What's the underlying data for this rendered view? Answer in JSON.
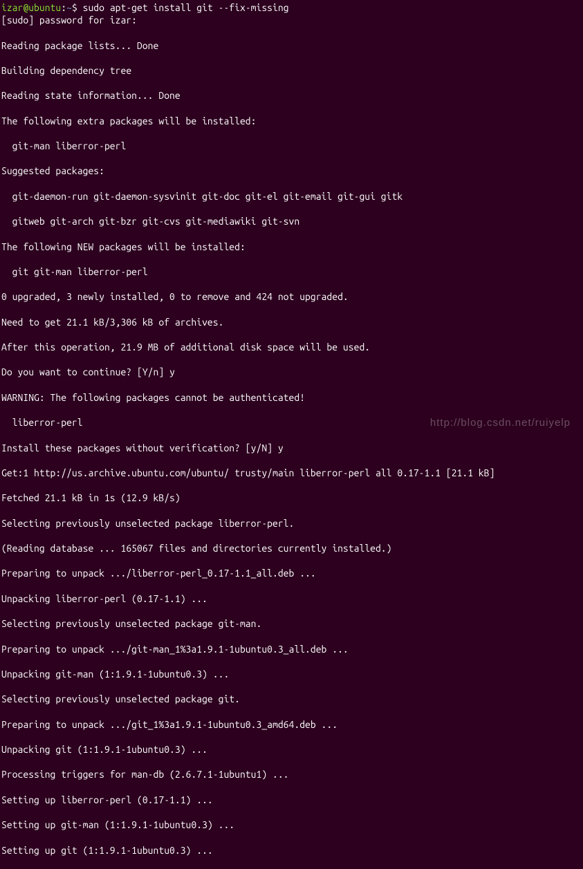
{
  "prompt": {
    "user_host": "izar@ubuntu",
    "separator": ":",
    "path": "~",
    "symbol": "$ ",
    "command": "sudo apt-get install git --fix-missing"
  },
  "lines": [
    "[sudo] password for izar: ",
    "Reading package lists... Done",
    "Building dependency tree       ",
    "Reading state information... Done",
    "The following extra packages will be installed:",
    "  git-man liberror-perl",
    "Suggested packages:",
    "  git-daemon-run git-daemon-sysvinit git-doc git-el git-email git-gui gitk",
    "  gitweb git-arch git-bzr git-cvs git-mediawiki git-svn",
    "The following NEW packages will be installed:",
    "  git git-man liberror-perl",
    "0 upgraded, 3 newly installed, 0 to remove and 424 not upgraded.",
    "Need to get 21.1 kB/3,306 kB of archives.",
    "After this operation, 21.9 MB of additional disk space will be used.",
    "Do you want to continue? [Y/n] y",
    "WARNING: The following packages cannot be authenticated!",
    "  liberror-perl",
    "Install these packages without verification? [y/N] y",
    "Get:1 http://us.archive.ubuntu.com/ubuntu/ trusty/main liberror-perl all 0.17-1.1 [21.1 kB]",
    "Fetched 21.1 kB in 1s (12.9 kB/s)",
    "Selecting previously unselected package liberror-perl.",
    "(Reading database ... 165067 files and directories currently installed.)",
    "Preparing to unpack .../liberror-perl_0.17-1.1_all.deb ...",
    "Unpacking liberror-perl (0.17-1.1) ...",
    "Selecting previously unselected package git-man.",
    "Preparing to unpack .../git-man_1%3a1.9.1-1ubuntu0.3_all.deb ...",
    "Unpacking git-man (1:1.9.1-1ubuntu0.3) ...",
    "Selecting previously unselected package git.",
    "Preparing to unpack .../git_1%3a1.9.1-1ubuntu0.3_amd64.deb ...",
    "Unpacking git (1:1.9.1-1ubuntu0.3) ...",
    "Processing triggers for man-db (2.6.7.1-1ubuntu1) ...",
    "Setting up liberror-perl (0.17-1.1) ...",
    "Setting up git-man (1:1.9.1-1ubuntu0.3) ...",
    "Setting up git (1:1.9.1-1ubuntu0.3) ..."
  ],
  "watermark": "http://blog.csdn.net/ruiyelp"
}
